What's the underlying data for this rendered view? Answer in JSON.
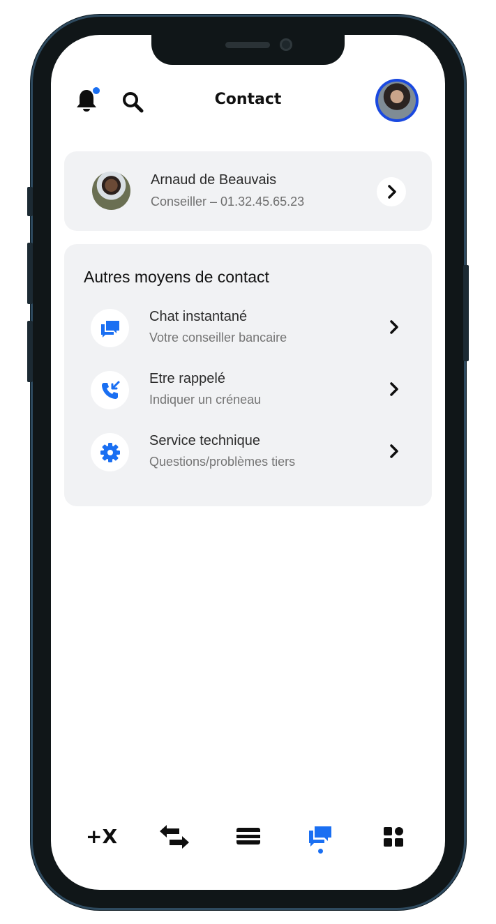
{
  "header": {
    "title": "Contact",
    "notification_indicator_color": "#1a6ff2"
  },
  "advisor": {
    "name": "Arnaud de Beauvais",
    "subtitle": "Conseiller – 01.32.45.65.23"
  },
  "other_contacts": {
    "title": "Autres moyens de contact",
    "items": [
      {
        "label": "Chat instantané",
        "sub": "Votre conseiller bancaire",
        "icon": "chat-bubbles-icon"
      },
      {
        "label": "Etre rappelé",
        "sub": "Indiquer un créneau",
        "icon": "phone-callback-icon"
      },
      {
        "label": "Service technique",
        "sub": "Questions/problèmes tiers",
        "icon": "gear-icon"
      }
    ]
  },
  "bottom_nav": {
    "items": [
      {
        "label": "+X",
        "icon": "plus-x-icon"
      },
      {
        "icon": "transfer-arrows-icon"
      },
      {
        "icon": "card-icon"
      },
      {
        "icon": "chat-bubbles-icon",
        "active": true
      },
      {
        "icon": "grid-apps-icon"
      }
    ],
    "active_color": "#1a6ff2"
  },
  "colors": {
    "accent": "#1a6ff2",
    "card_bg": "#f1f2f4"
  }
}
